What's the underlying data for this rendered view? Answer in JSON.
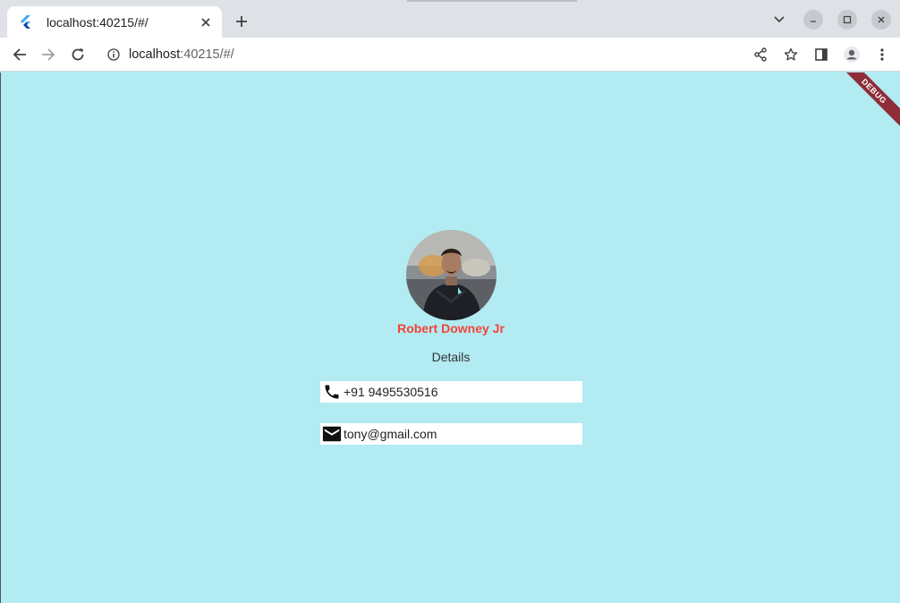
{
  "browser": {
    "tab_title": "localhost:40215/#/",
    "url_host": "localhost",
    "url_rest": ":40215/#/",
    "icons": {
      "favicon": "flutter-icon",
      "tab_close": "close-icon",
      "new_tab": "plus-icon",
      "tab_search": "chevron-down-icon",
      "minimize": "minimize-icon",
      "maximize": "maximize-icon",
      "close": "close-icon",
      "back": "arrow-left-icon",
      "forward": "arrow-right-icon",
      "reload": "reload-icon",
      "site_info": "info-icon",
      "share": "share-icon",
      "bookmark": "star-icon",
      "side_panel": "side-panel-icon",
      "profile": "profile-icon",
      "menu": "kebab-menu-icon"
    }
  },
  "app": {
    "debug_label": "DEBUG",
    "profile": {
      "name": "Robert Downey Jr",
      "section_label": "Details",
      "phone": "+91 9495530516",
      "email": "tony@gmail.com"
    },
    "colors": {
      "background": "#b2ebf2",
      "name": "#f44336",
      "debug_ribbon": "#8e2d38",
      "field_bg": "#ffffff"
    },
    "icons": {
      "phone": "phone-icon",
      "email": "mail-icon"
    }
  }
}
